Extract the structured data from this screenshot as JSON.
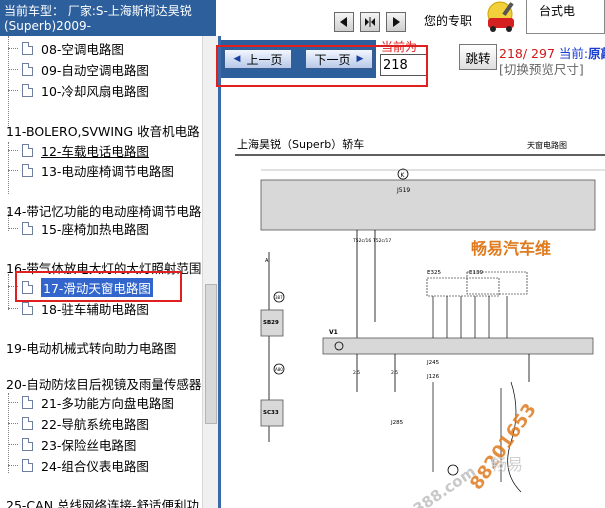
{
  "header": {
    "model_line1": "当前车型：  厂家:S-上海斯柯达昊锐",
    "model_line2": "(Superb)2009-",
    "welcome": "您的专职",
    "desk_label": "台式电"
  },
  "icons": {
    "first": "first-page-icon",
    "middle": "split-view-icon",
    "last": "last-page-icon",
    "logo": "car-repair-logo-icon"
  },
  "sidebar": {
    "items": [
      {
        "label": "08-空调电路图"
      },
      {
        "label": "09-自动空调电路图"
      },
      {
        "label": "10-冷却风扇电路图"
      },
      {
        "label": "11-BOLERO,SVWING 收音机电路"
      },
      {
        "label": "12-车载电话电路图"
      },
      {
        "label": "13-电动座椅调节电路图"
      },
      {
        "label": "14-带记忆功能的电动座椅调节电路"
      },
      {
        "label": "15-座椅加热电路图"
      },
      {
        "label": "16-带气体放电大灯的大灯照射范围"
      },
      {
        "label": "17-滑动天窗电路图"
      },
      {
        "label": "18-驻车辅助电路图"
      },
      {
        "label": "19-电动机械式转向助力电路图"
      },
      {
        "label": "20-自动防炫目后视镜及雨量传感器"
      },
      {
        "label": "21-多功能方向盘电路图"
      },
      {
        "label": "22-导航系统电路图"
      },
      {
        "label": "23-保险丝电路图"
      },
      {
        "label": "24-组合仪表电路图"
      },
      {
        "label": "25-CAN 总线网络连接-舒适便利功"
      }
    ]
  },
  "toolbar": {
    "prev_label": "上一页",
    "next_label": "下一页",
    "current_label": "当前为",
    "page_value": "218",
    "jump_label": "跳转",
    "page_count": "218/ 297",
    "current_prefix": "当前:",
    "current_name": "原敲",
    "preview_label": "[切换预览尺寸]"
  },
  "diagram": {
    "title": "上海昊锐（Superb）轿车",
    "subtitle": "天窗电路图",
    "watermark": "畅易汽车维",
    "watermark2": "88201653",
    "watermark3": "car388.com",
    "watermark4": "畅易",
    "labels": {
      "j519": "J519",
      "j245": "J245",
      "j285": "J285",
      "j126": "J126",
      "e325": "E325",
      "e139": "E139",
      "sb29": "SB29",
      "sc33": "SC33",
      "v1": "V1",
      "k": "K"
    }
  },
  "colors": {
    "header_blue": "#2d5f9c",
    "highlight_red": "#e02020",
    "select_blue": "#3366cc"
  }
}
